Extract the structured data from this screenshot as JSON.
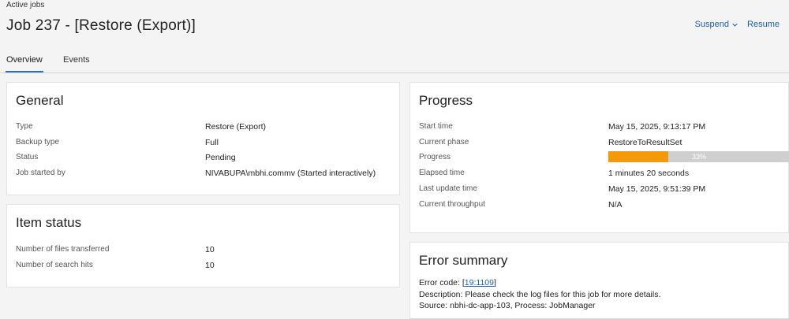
{
  "breadcrumb": {
    "label": "Active jobs"
  },
  "header": {
    "title": "Job 237 - [Restore (Export)]",
    "suspend_label": "Suspend",
    "resume_label": "Resume"
  },
  "tabs": [
    {
      "label": "Overview",
      "active": true
    },
    {
      "label": "Events",
      "active": false
    }
  ],
  "general": {
    "title": "General",
    "rows": [
      {
        "label": "Type",
        "value": "Restore (Export)"
      },
      {
        "label": "Backup type",
        "value": "Full"
      },
      {
        "label": "Status",
        "value": "Pending"
      },
      {
        "label": "Job started by",
        "value": "NIVABUPA\\mbhi.commv (Started interactively)"
      }
    ]
  },
  "item_status": {
    "title": "Item status",
    "rows": [
      {
        "label": "Number of files transferred",
        "value": "10"
      },
      {
        "label": "Number of search hits",
        "value": "10"
      }
    ]
  },
  "progress": {
    "title": "Progress",
    "start_time_label": "Start time",
    "start_time": "May 15, 2025, 9:13:17 PM",
    "current_phase_label": "Current phase",
    "current_phase": "RestoreToResultSet",
    "progress_label": "Progress",
    "progress_text": "33%",
    "progress_value": 0.33,
    "elapsed_label": "Elapsed time",
    "elapsed": "1 minutes 20 seconds",
    "last_update_label": "Last update time",
    "last_update": "May 15, 2025, 9:51:39 PM",
    "throughput_label": "Current throughput",
    "throughput": "N/A"
  },
  "error_summary": {
    "title": "Error summary",
    "code_prefix": "Error code: [",
    "code": "19:1109",
    "code_suffix": "]",
    "description": "Description: Please check the log files for this job for more details.",
    "source": "Source: nbhi-dc-app-103, Process: JobManager"
  },
  "colors": {
    "accent": "#1f5fa6",
    "progress_fill": "#f39a0a",
    "progress_track": "#cfcfcf"
  }
}
